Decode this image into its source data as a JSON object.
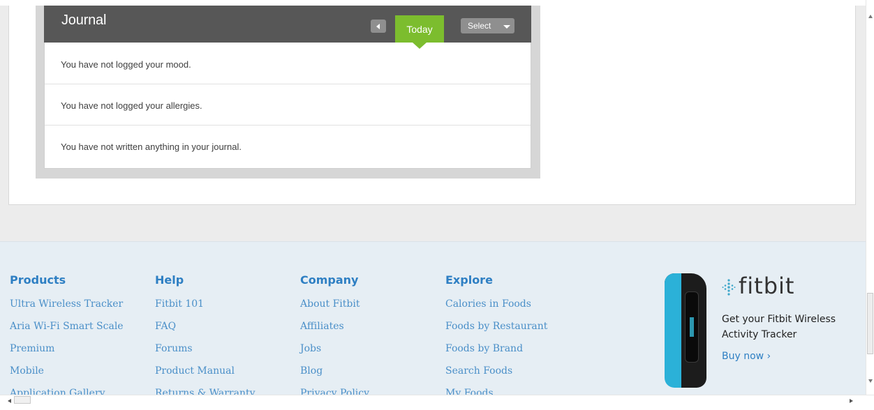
{
  "journal": {
    "title": "Journal",
    "today_label": "Today",
    "select_label": "Select",
    "rows": [
      "You have not logged your mood.",
      "You have not logged your allergies.",
      "You have not written anything in your journal."
    ]
  },
  "footer": {
    "columns": [
      {
        "heading": "Products",
        "links": [
          "Ultra Wireless Tracker",
          "Aria Wi-Fi Smart Scale",
          "Premium",
          "Mobile",
          "Application Gallery"
        ]
      },
      {
        "heading": "Help",
        "links": [
          "Fitbit 101",
          "FAQ",
          "Forums",
          "Product Manual",
          "Returns & Warranty"
        ]
      },
      {
        "heading": "Company",
        "links": [
          "About Fitbit",
          "Affiliates",
          "Jobs",
          "Blog",
          "Privacy Policy"
        ]
      },
      {
        "heading": "Explore",
        "links": [
          "Calories in Foods",
          "Foods by Restaurant",
          "Foods by Brand",
          "Search Foods",
          "My Foods"
        ]
      }
    ]
  },
  "promo": {
    "brand": "fitbit",
    "text": "Get your Fitbit Wireless Activity Tracker",
    "cta": "Buy now ›"
  },
  "colors": {
    "accent_green": "#7cbd2e",
    "header_gray": "#575757",
    "link_blue": "#4a8fc8",
    "heading_blue": "#2e7fc3",
    "device_blue": "#2bb1d8"
  },
  "icons": [
    "chevron-left-icon",
    "caret-down-icon",
    "fitbit-logo-icon",
    "fitbit-tracker-image",
    "scroll-up-icon",
    "scroll-down-icon",
    "scroll-left-icon",
    "scroll-right-icon"
  ]
}
